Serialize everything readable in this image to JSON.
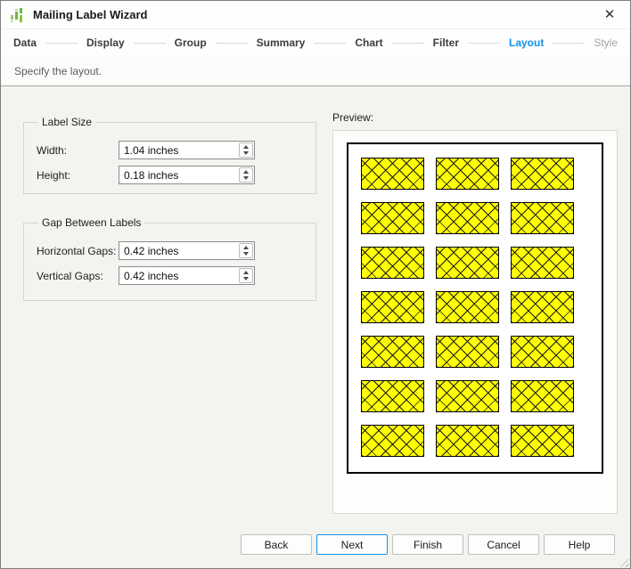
{
  "window": {
    "title": "Mailing Label Wizard",
    "close_glyph": "✕"
  },
  "steps": {
    "items": [
      {
        "label": "Data",
        "state": "done"
      },
      {
        "label": "Display",
        "state": "done"
      },
      {
        "label": "Group",
        "state": "done"
      },
      {
        "label": "Summary",
        "state": "done"
      },
      {
        "label": "Chart",
        "state": "done"
      },
      {
        "label": "Filter",
        "state": "done"
      },
      {
        "label": "Layout",
        "state": "active"
      },
      {
        "label": "Style",
        "state": "upcoming"
      }
    ]
  },
  "subtitle": "Specify the layout.",
  "label_size": {
    "legend": "Label Size",
    "fields": [
      {
        "label": "Width:",
        "value": "1.04 inches"
      },
      {
        "label": "Height:",
        "value": "0.18 inches"
      }
    ]
  },
  "gaps": {
    "legend": "Gap Between Labels",
    "fields": [
      {
        "label": "Horizontal Gaps:",
        "value": "0.42 inches"
      },
      {
        "label": "Vertical Gaps:",
        "value": "0.42 inches"
      }
    ]
  },
  "preview": {
    "label": "Preview:",
    "grid": {
      "rows": 7,
      "columns": 3
    }
  },
  "footer": {
    "buttons": [
      {
        "label": "Back",
        "default": false
      },
      {
        "label": "Next",
        "default": true
      },
      {
        "label": "Finish",
        "default": false
      },
      {
        "label": "Cancel",
        "default": false
      },
      {
        "label": "Help",
        "default": false
      }
    ]
  },
  "colors": {
    "accent": "#1592e6",
    "label-fill": "#ffff00",
    "hatch": "#1a1a1a",
    "done-step": "#3b3b3b",
    "upcoming-step": "#a6a6a6"
  }
}
